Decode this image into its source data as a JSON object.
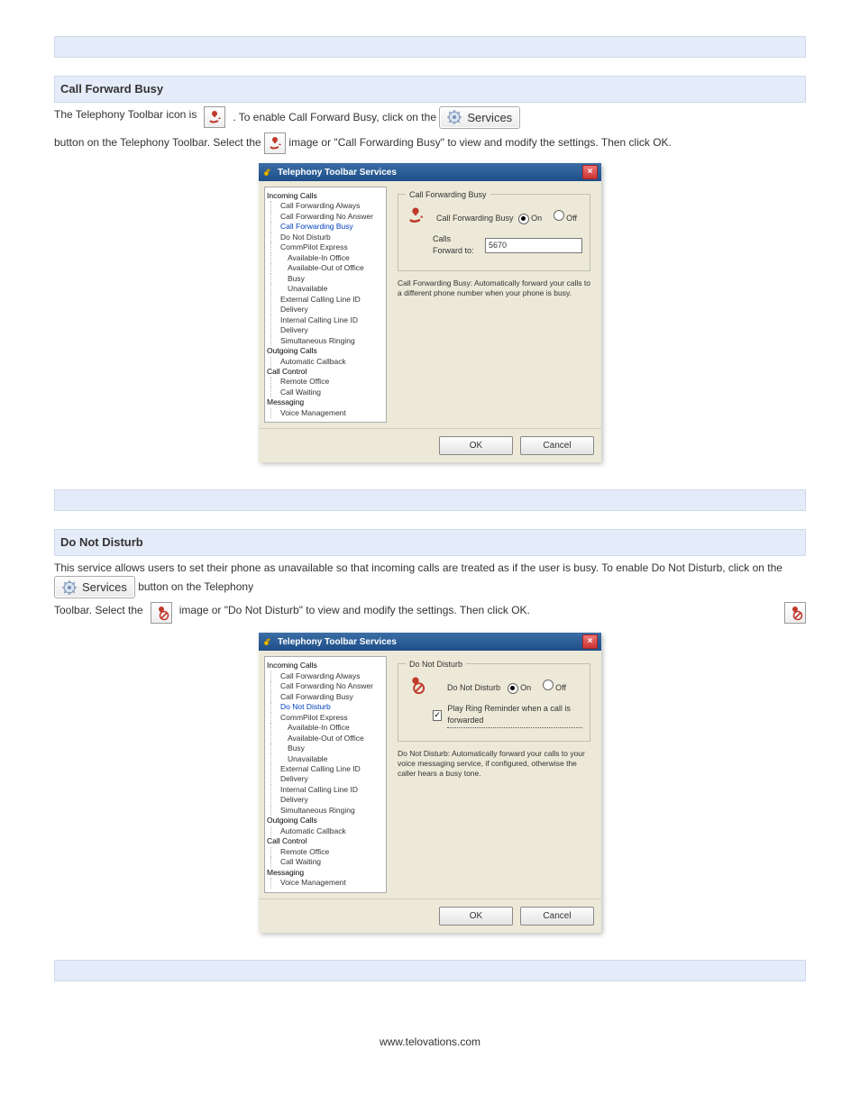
{
  "header_bar": "",
  "svc_btn_label": "Services",
  "tree": {
    "incoming": "Incoming Calls",
    "items_incoming": [
      "Call Forwarding Always",
      "Call Forwarding No Answer",
      "Call Forwarding Busy",
      "Do Not Disturb",
      "CommPilot Express"
    ],
    "sub_commpilot": [
      "Available-In Office",
      "Available-Out of Office",
      "Busy",
      "Unavailable"
    ],
    "items_incoming2": [
      "External Calling Line ID Delivery",
      "Internal Calling Line ID Delivery",
      "Simultaneous Ringing"
    ],
    "outgoing": "Outgoing Calls",
    "items_outgoing": [
      "Automatic Callback"
    ],
    "callcontrol": "Call Control",
    "items_callcontrol": [
      "Remote Office",
      "Call Waiting"
    ],
    "messaging": "Messaging",
    "items_messaging": [
      "Voice Management"
    ]
  },
  "dialog_title": "Telephony Toolbar Services",
  "section1": {
    "title": "Call Forward Busy",
    "copy_line": "The Telephony Toolbar icon is       . To enable Call Forward Busy, click on the",
    "copy_line2": "button on the Telephony Toolbar. Select the       image or \"Call Forwarding Busy\" to view and modify the settings. Then click OK.",
    "fieldset_legend": "Call Forwarding Busy",
    "label_main": "Call Forwarding Busy",
    "on": "On",
    "off": "Off",
    "fwd_to_label": "Calls Forward to:",
    "fwd_to_value": "5670",
    "desc": "Call Forwarding Busy: Automatically forward your calls to a different phone number when your phone is busy.",
    "ok": "OK",
    "cancel": "Cancel"
  },
  "section2": {
    "title": "Do Not Disturb",
    "copy_line": "This service allows users to set their phone as unavailable so that incoming calls are treated as if the user is busy. To enable Do Not Disturb, click on the       button on the Telephony",
    "copy_line2": "Toolbar. Select the       image or \"Do Not Disturb\" to view and modify the settings. Then click OK.",
    "fieldset_legend": "Do Not Disturb",
    "label_main": "Do Not Disturb",
    "on": "On",
    "off": "Off",
    "chk_label": "Play Ring Reminder when a call is forwarded",
    "desc": "Do Not Disturb: Automatically forward your calls to your voice messaging service, if configured, otherwise the caller hears a busy tone.",
    "ok": "OK",
    "cancel": "Cancel"
  },
  "footer_url": "www.telovations.com"
}
